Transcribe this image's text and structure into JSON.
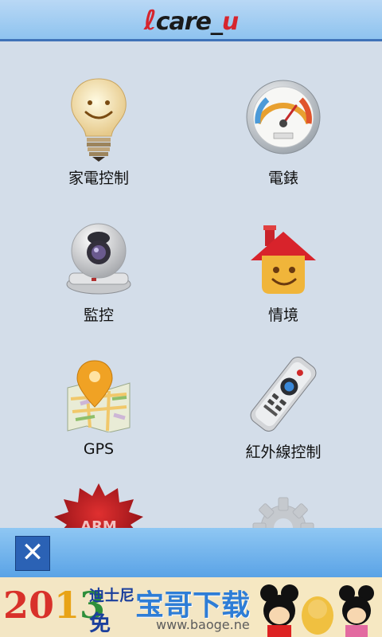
{
  "header": {
    "logo_main": "care",
    "logo_sep": "_",
    "logo_tail": "u"
  },
  "tiles": [
    {
      "label": "家電控制",
      "icon": "lightbulb-smiley-icon"
    },
    {
      "label": "電錶",
      "icon": "power-meter-gauge-icon"
    },
    {
      "label": "監控",
      "icon": "security-camera-icon"
    },
    {
      "label": "情境",
      "icon": "smiley-house-icon"
    },
    {
      "label": "GPS",
      "icon": "gps-map-pin-icon"
    },
    {
      "label": "紅外線控制",
      "icon": "infrared-remote-icon"
    },
    {
      "label": "",
      "icon": "arm-badge-icon"
    },
    {
      "label": "",
      "icon": "settings-gear-icon"
    }
  ],
  "arm_badge_text": "ARM",
  "bottom_bar": {
    "close_label": "✕"
  },
  "ad": {
    "year_a": "20",
    "year_b": "1",
    "year_c": "3",
    "disney": "迪士尼",
    "free": "免",
    "brand": "宝哥下载",
    "url": "www.baoge.net"
  },
  "colors": {
    "header_bg": "#8ec3ef",
    "header_border": "#3f73b8",
    "page_bg": "#d3dde9",
    "bottom_bar_bg": "#5aa3e6",
    "close_button_bg": "#2b62b5",
    "logo_accent": "#d6252e"
  }
}
